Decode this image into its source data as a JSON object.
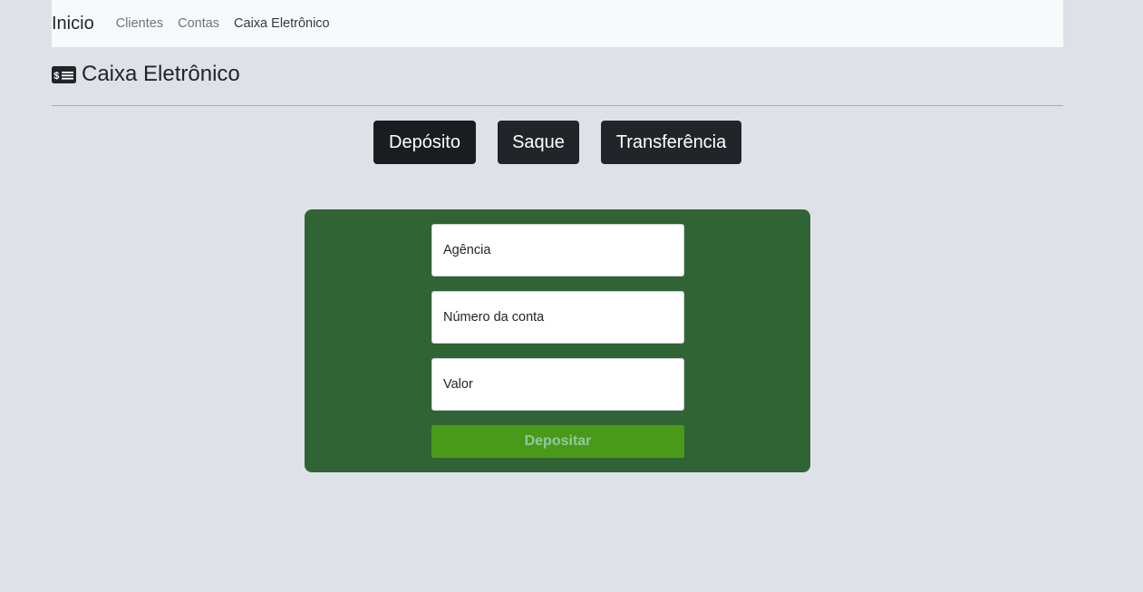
{
  "navbar": {
    "brand": "Inicio",
    "links": [
      {
        "label": "Clientes",
        "active": false
      },
      {
        "label": "Contas",
        "active": false
      },
      {
        "label": "Caixa Eletrônico",
        "active": true
      }
    ]
  },
  "header": {
    "icon": "money-card-icon",
    "title": "Caixa Eletrônico"
  },
  "actions": {
    "deposito": "Depósito",
    "saque": "Saque",
    "transferencia": "Transferência",
    "selected": "deposito"
  },
  "form": {
    "agencia": {
      "placeholder": "Agência",
      "value": ""
    },
    "conta": {
      "placeholder": "Número da conta",
      "value": ""
    },
    "valor": {
      "placeholder": "Valor",
      "value": ""
    },
    "submit_label": "Depositar"
  },
  "colors": {
    "page_background": "#dfe1e8",
    "panel_green": "#306434",
    "submit_green": "#4a9a1a",
    "dark_button": "#212529"
  }
}
